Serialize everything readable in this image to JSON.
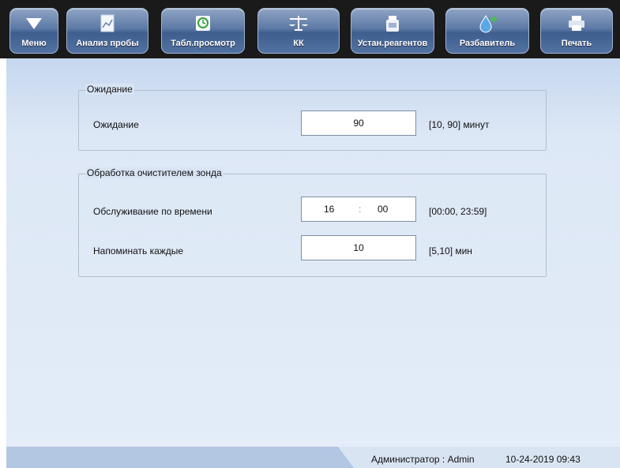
{
  "toolbar": {
    "menu": "Меню",
    "analysis": "Анализ пробы",
    "table_view": "Табл.просмотр",
    "qc": "КК",
    "reagent_setup": "Устан.реагентов",
    "diluent": "Разбавитель",
    "print": "Печать"
  },
  "wait_group": {
    "legend": "Ожидание",
    "label": "Ожидание",
    "value": "90",
    "range": "[10, 90] минут"
  },
  "probe_group": {
    "legend": "Обработка очистителем зонда",
    "time_label": "Обслуживание по времени",
    "hour": "16",
    "sep": ":",
    "minute": "00",
    "time_range": "[00:00, 23:59]",
    "remind_label": "Напоминать каждые",
    "remind_value": "10",
    "remind_range": "[5,10] мин"
  },
  "status": {
    "user": "Администратор : Admin",
    "datetime": "10-24-2019 09:43"
  },
  "colors": {
    "toolbar_bg": "#1a1a1a",
    "button_blue": "#4f6f9f",
    "content_bg": "#dde8f6"
  }
}
